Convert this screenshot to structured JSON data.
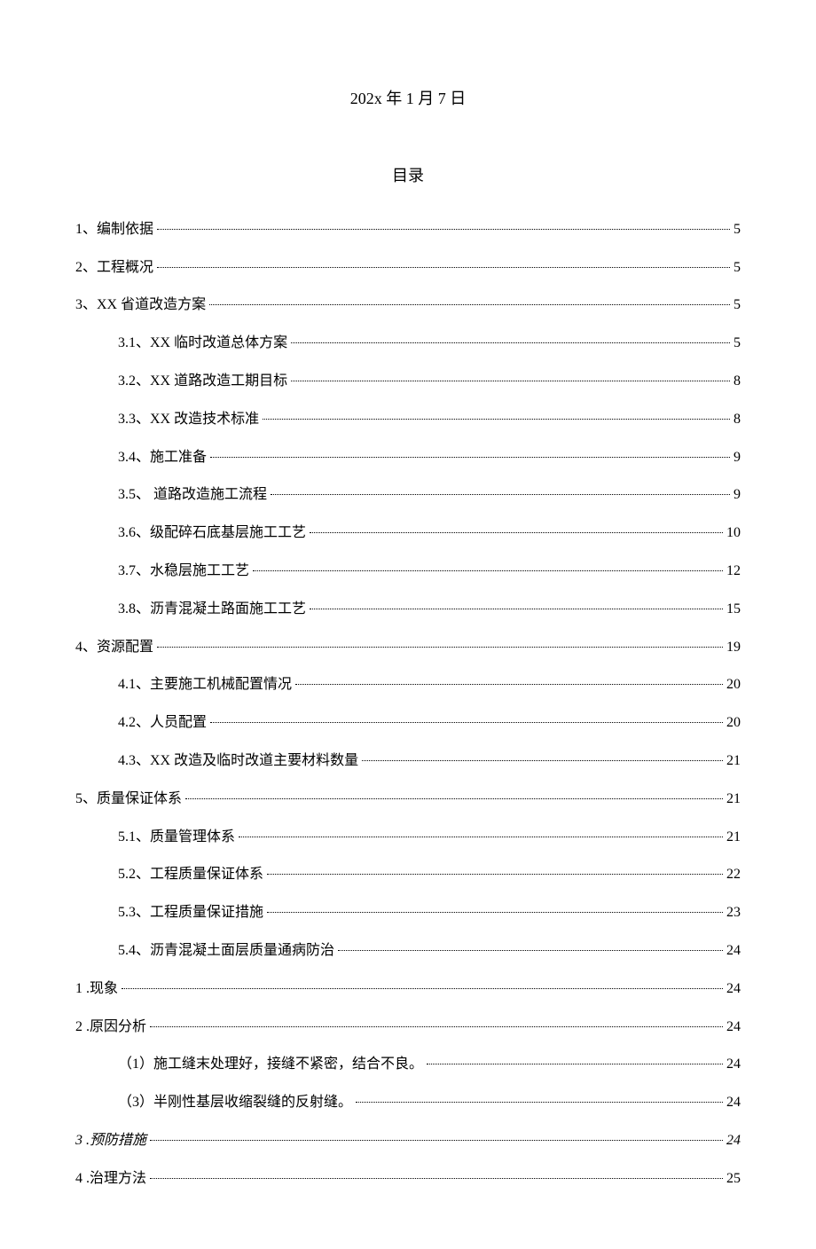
{
  "header": {
    "date": "202x 年 1 月 7 日",
    "title": "目录"
  },
  "toc": [
    {
      "label": "1、编制依据",
      "page": "5",
      "indent": 0,
      "italic": false
    },
    {
      "label": "2、工程概况",
      "page": "5",
      "indent": 0,
      "italic": false
    },
    {
      "label": "3、XX 省道改造方案 ",
      "page": "5",
      "indent": 0,
      "italic": false
    },
    {
      "label": "3.1、XX 临时改道总体方案",
      "page": "5",
      "indent": 1,
      "italic": false
    },
    {
      "label": "3.2、XX 道路改造工期目标",
      "page": "8",
      "indent": 1,
      "italic": false
    },
    {
      "label": "3.3、XX 改造技术标准",
      "page": "8",
      "indent": 1,
      "italic": false
    },
    {
      "label": "3.4、施工准备 ",
      "page": "9",
      "indent": 1,
      "italic": false
    },
    {
      "label": "3.5、 道路改造施工流程 ",
      "page": "9",
      "indent": 1,
      "italic": false
    },
    {
      "label": "3.6、级配碎石底基层施工工艺 ",
      "page": "10",
      "indent": 1,
      "italic": false
    },
    {
      "label": "3.7、水稳层施工工艺 ",
      "page": "12",
      "indent": 1,
      "italic": false
    },
    {
      "label": "3.8、沥青混凝土路面施工工艺 ",
      "page": "15",
      "indent": 1,
      "italic": false
    },
    {
      "label": "4、资源配置",
      "page": "19",
      "indent": 0,
      "italic": false
    },
    {
      "label": "4.1、主要施工机械配置情况 ",
      "page": "20",
      "indent": 1,
      "italic": false
    },
    {
      "label": "4.2、人员配置 ",
      "page": "20",
      "indent": 1,
      "italic": false
    },
    {
      "label": "4.3、XX 改造及临时改道主要材料数量",
      "page": "21",
      "indent": 1,
      "italic": false
    },
    {
      "label": "5、质量保证体系",
      "page": "21",
      "indent": 0,
      "italic": false
    },
    {
      "label": "5.1、质量管理体系 ",
      "page": "21",
      "indent": 1,
      "italic": false
    },
    {
      "label": "5.2、工程质量保证体系 ",
      "page": "22",
      "indent": 1,
      "italic": false
    },
    {
      "label": "5.3、工程质量保证措施 ",
      "page": "23",
      "indent": 1,
      "italic": false
    },
    {
      "label": "5.4、沥青混凝土面层质量通病防治 ",
      "page": "24",
      "indent": 1,
      "italic": false
    },
    {
      "label": "1 .现象 ",
      "page": "24",
      "indent": 0,
      "italic": false
    },
    {
      "label": "2 .原因分析 ",
      "page": "24",
      "indent": 0,
      "italic": false
    },
    {
      "label": "（1）施工缝末处理好，接缝不紧密，结合不良。 ",
      "page": "24",
      "indent": 2,
      "italic": false
    },
    {
      "label": "（3）半刚性基层收缩裂缝的反射缝。 ",
      "page": "24",
      "indent": 2,
      "italic": false
    },
    {
      "label": "3 .预防措施 ",
      "page": "24",
      "indent": 0,
      "italic": true
    },
    {
      "label": "4 .治理方法 ",
      "page": "25",
      "indent": 0,
      "italic": false
    }
  ]
}
